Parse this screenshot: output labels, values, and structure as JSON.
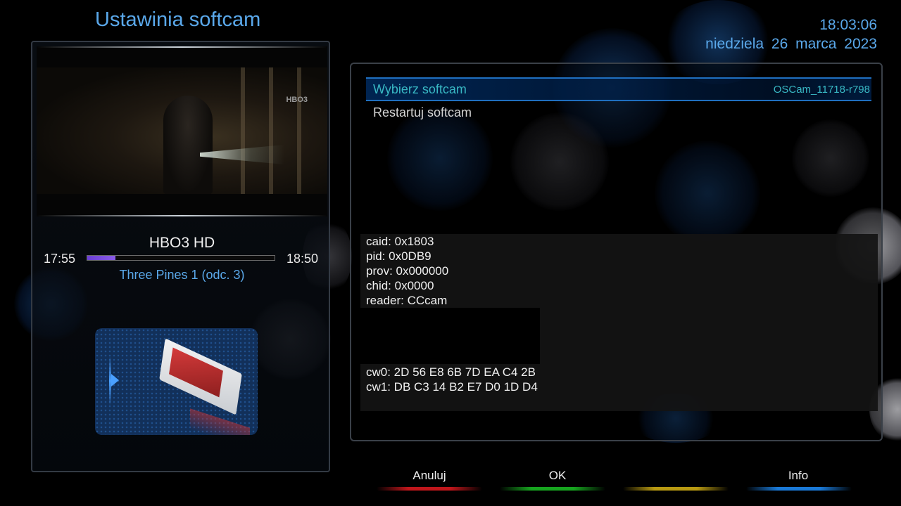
{
  "header": {
    "title": "Ustawinia softcam",
    "clock": "18:03:06",
    "date": "niedziela 26 marca 2023"
  },
  "channel": {
    "name": "HBO3 HD",
    "logo_text": "HBO3",
    "start_time": "17:55",
    "end_time": "18:50",
    "progress_fraction": 0.15,
    "event_title": "Three Pines 1 (odc. 3)"
  },
  "menu": {
    "items": [
      {
        "label": "Wybierz softcam",
        "value": "OSCam_11718-r798"
      },
      {
        "label": "Restartuj softcam"
      }
    ]
  },
  "ecm_info": {
    "caid": "caid: 0x1803",
    "pid": "pid: 0x0DB9",
    "prov": "prov: 0x000000",
    "chid": "chid: 0x0000",
    "reader": "reader: CCcam",
    "cw0": "cw0: 2D 56 E8 6B 7D EA C4 2B",
    "cw1": "cw1: DB C3 14 B2 E7 D0 1D D4"
  },
  "buttons": {
    "red": "Anuluj",
    "green": "OK",
    "yellow": "",
    "blue": "Info"
  },
  "colors": {
    "accent_blue": "#5aa8ea",
    "menu_text_selected": "#38b8c4",
    "red_button": "#c0161b",
    "green_button": "#17a51f",
    "yellow_button": "#b89a12",
    "blue_button": "#1a7ad8"
  }
}
